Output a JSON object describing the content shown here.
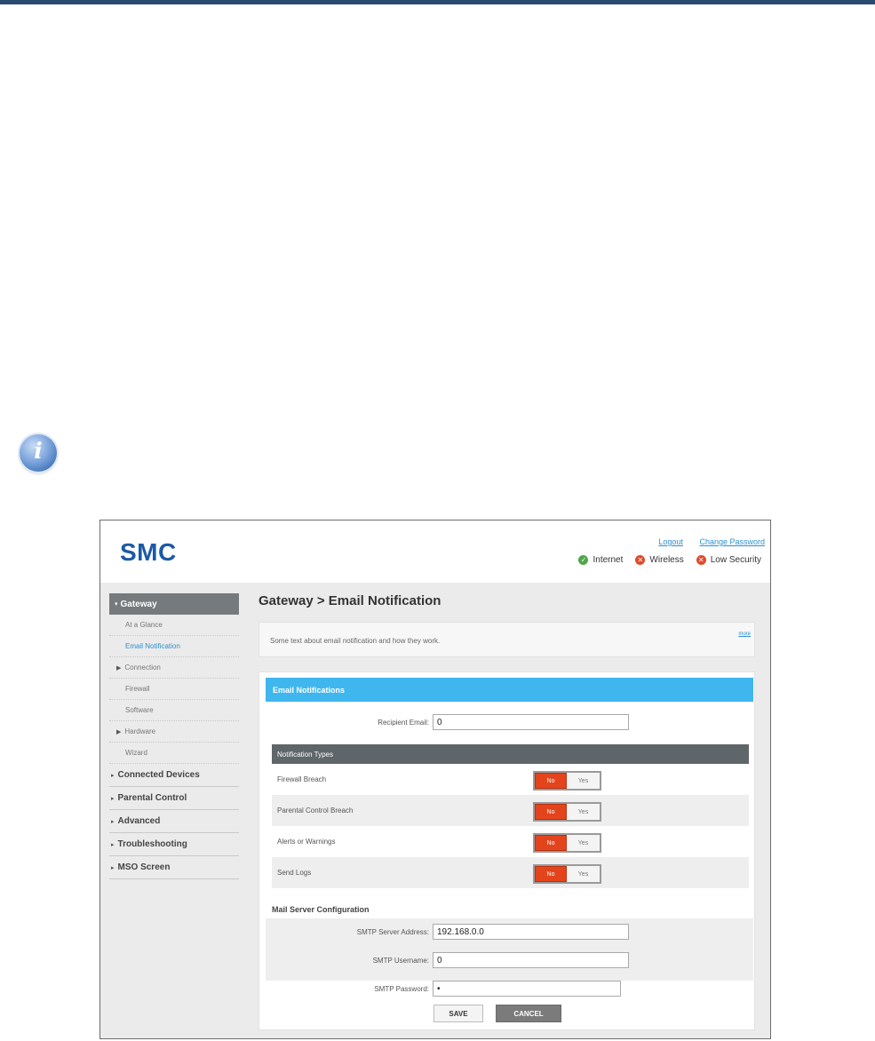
{
  "brand": {
    "logo": "SMC"
  },
  "header": {
    "links": {
      "logout": "Logout",
      "change_password": "Change Password"
    },
    "status": [
      {
        "label": "Internet",
        "state": "ok",
        "icon": "check-circle-icon",
        "color": "#4ea64a"
      },
      {
        "label": "Wireless",
        "state": "error",
        "icon": "x-circle-icon",
        "color": "#e04a2b"
      },
      {
        "label": "Low Security",
        "state": "error",
        "icon": "x-circle-icon",
        "color": "#e04a2b"
      }
    ]
  },
  "sidebar": {
    "gateway": "Gateway",
    "subitems": [
      "At a Glance",
      "Email Notification",
      "Connection",
      "Firewall",
      "Software",
      "Hardware",
      "Wizard"
    ],
    "main_items": [
      "Connected Devices",
      "Parental Control",
      "Advanced",
      "Troubleshooting",
      "MSO Screen"
    ]
  },
  "page": {
    "title": "Gateway > Email Notification",
    "description": "Some text about email notification and how they work.",
    "more_link": "more"
  },
  "email_panel": {
    "title": "Email Notifications",
    "recipient_label": "Recipient Email:",
    "recipient_value": "0",
    "types_title": "Notification Types",
    "types": [
      {
        "label": "Firewall Breach",
        "no": "No",
        "yes": "Yes",
        "selected": "No"
      },
      {
        "label": "Parental Control Breach",
        "no": "No",
        "yes": "Yes",
        "selected": "No"
      },
      {
        "label": "Alerts or Warnings",
        "no": "No",
        "yes": "Yes",
        "selected": "No"
      },
      {
        "label": "Send Logs",
        "no": "No",
        "yes": "Yes",
        "selected": "No"
      }
    ],
    "mail_title": "Mail Server Configuration",
    "smtp_address_label": "SMTP Server Address:",
    "smtp_address_value": "192.168.0.0",
    "smtp_user_label": "SMTP Username:",
    "smtp_user_value": "0",
    "smtp_password_label": "SMTP Password:",
    "smtp_password_value": "•",
    "save_label": "SAVE",
    "cancel_label": "CANCEL"
  },
  "colors": {
    "accent_blue": "#3fb6ee",
    "toggle_no": "#e4441c",
    "logo_blue": "#1b5aa6",
    "sidebar_header": "#777a7c"
  }
}
